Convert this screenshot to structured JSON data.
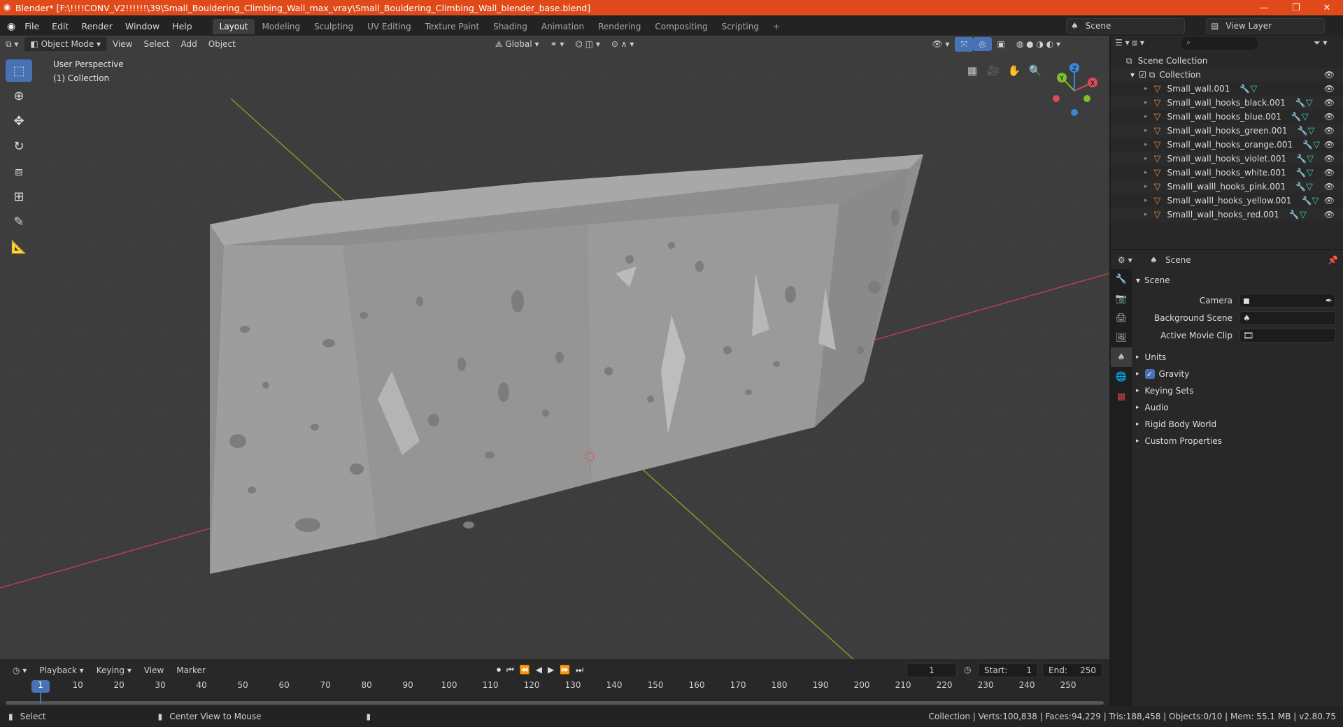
{
  "window": {
    "title": "Blender* [F:\\!!!!CONV_V2!!!!!!\\39\\Small_Bouldering_Climbing_Wall_max_vray\\Small_Bouldering_Climbing_Wall_blender_base.blend]",
    "minimize": "—",
    "maximize": "❐",
    "close": "✕"
  },
  "menubar": {
    "items": [
      "File",
      "Edit",
      "Render",
      "Window",
      "Help"
    ],
    "workspaces": [
      "Layout",
      "Modeling",
      "Sculpting",
      "UV Editing",
      "Texture Paint",
      "Shading",
      "Animation",
      "Rendering",
      "Compositing",
      "Scripting"
    ],
    "add_workspace": "+",
    "scene_label": "Scene",
    "view_layer_label": "View Layer"
  },
  "viewport_header": {
    "mode": "Object Mode",
    "menus": [
      "View",
      "Select",
      "Add",
      "Object"
    ],
    "orientation": "Global"
  },
  "viewport": {
    "perspective": "User Perspective",
    "collection": "(1) Collection",
    "gizmo_axes": [
      "X",
      "Y",
      "Z"
    ]
  },
  "outliner": {
    "root": "Scene Collection",
    "collection": "Collection",
    "objects": [
      "Small_wall.001",
      "Small_wall_hooks_black.001",
      "Small_wall_hooks_blue.001",
      "Small_wall_hooks_green.001",
      "Small_wall_hooks_orange.001",
      "Small_wall_hooks_violet.001",
      "Small_wall_hooks_white.001",
      "Smalll_walll_hooks_pink.001",
      "Small_walll_hooks_yellow.001",
      "Smalll_wall_hooks_red.001"
    ]
  },
  "properties": {
    "header": "Scene",
    "section": "Scene",
    "fields": [
      {
        "label": "Camera"
      },
      {
        "label": "Background Scene"
      },
      {
        "label": "Active Movie Clip"
      }
    ],
    "panels": [
      "Units",
      "Gravity",
      "Keying Sets",
      "Audio",
      "Rigid Body World",
      "Custom Properties"
    ],
    "gravity_checked": true
  },
  "timeline": {
    "menus": [
      "Playback",
      "Keying",
      "View",
      "Marker"
    ],
    "current_frame": "1",
    "start_label": "Start:",
    "start": "1",
    "end_label": "End:",
    "end": "250",
    "ticks": [
      "1",
      "10",
      "20",
      "30",
      "40",
      "50",
      "60",
      "70",
      "80",
      "90",
      "100",
      "110",
      "120",
      "130",
      "140",
      "150",
      "160",
      "170",
      "180",
      "190",
      "200",
      "210",
      "220",
      "230",
      "240",
      "250"
    ]
  },
  "statusbar": {
    "left": "Select",
    "middle": "Center View to Mouse",
    "right": "Collection | Verts:100,838 | Faces:94,229 | Tris:188,458 | Objects:0/10 | Mem: 55.1 MB | v2.80.75"
  },
  "colors": {
    "title_bar": "#e04a1a",
    "accent": "#4772b3",
    "viewport_bg": "#3d3d3d",
    "mesh_icon": "#e5893c",
    "x_axis": "#d94a5a",
    "y_axis": "#7fbf2a",
    "z_axis": "#3a86d8"
  }
}
